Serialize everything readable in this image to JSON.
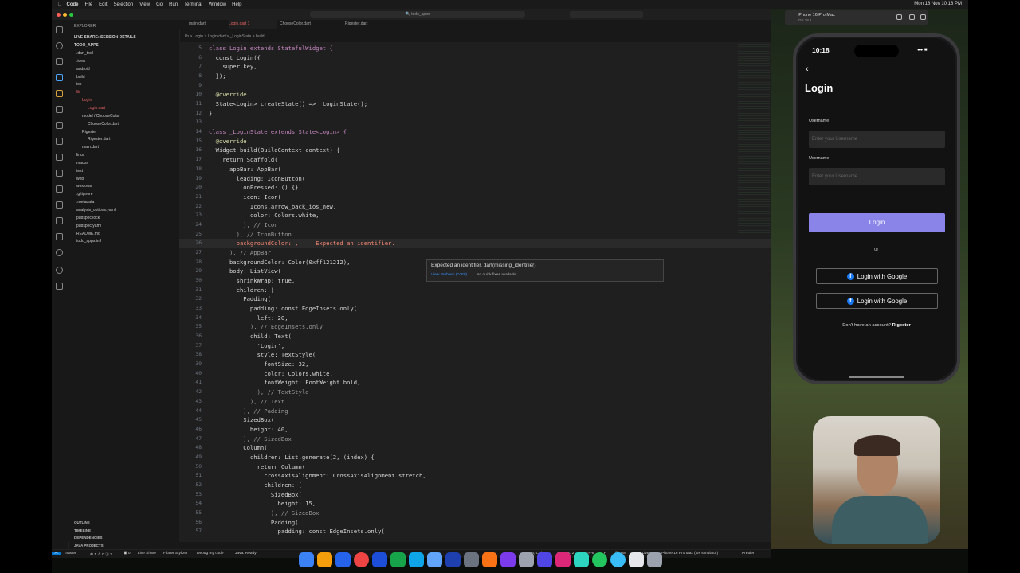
{
  "menubar": {
    "app": "Code",
    "items": [
      "File",
      "Edit",
      "Selection",
      "View",
      "Go",
      "Run",
      "Terminal",
      "Window",
      "Help"
    ],
    "clock": "Mon 18 Nov 10:18 PM"
  },
  "vscode": {
    "search": "todo_apps",
    "explorer": {
      "title": "EXPLORER",
      "live_share": "LIVE SHARE: SESSION DETAILS",
      "project": "TODO_APPS",
      "tree": [
        {
          "label": ".dart_tool",
          "indent": 1
        },
        {
          "label": ".idea",
          "indent": 1
        },
        {
          "label": "android",
          "indent": 1
        },
        {
          "label": "build",
          "indent": 1
        },
        {
          "label": "ios",
          "indent": 1
        },
        {
          "label": "lib",
          "indent": 1,
          "active": true
        },
        {
          "label": "Login",
          "indent": 2,
          "active": true
        },
        {
          "label": "Login.dart",
          "indent": 3,
          "active": true
        },
        {
          "label": "model / ChooseColor",
          "indent": 2
        },
        {
          "label": "ChooseColor.dart",
          "indent": 3
        },
        {
          "label": "Rigester",
          "indent": 2
        },
        {
          "label": "Rigester.dart",
          "indent": 3
        },
        {
          "label": "main.dart",
          "indent": 2
        },
        {
          "label": "linux",
          "indent": 1
        },
        {
          "label": "macos",
          "indent": 1
        },
        {
          "label": "test",
          "indent": 1
        },
        {
          "label": "web",
          "indent": 1
        },
        {
          "label": "windows",
          "indent": 1
        },
        {
          "label": ".gitignore",
          "indent": 1
        },
        {
          "label": ".metadata",
          "indent": 1
        },
        {
          "label": "analysis_options.yaml",
          "indent": 1
        },
        {
          "label": "pubspec.lock",
          "indent": 1
        },
        {
          "label": "pubspec.yaml",
          "indent": 1
        },
        {
          "label": "README.md",
          "indent": 1
        },
        {
          "label": "todo_apps.iml",
          "indent": 1
        }
      ],
      "bottom": [
        "OUTLINE",
        "TIMELINE",
        "DEPENDENCIES",
        "JAVA PROJECTS"
      ]
    },
    "tabs": [
      "main.dart",
      "Login.dart 1",
      "ChooseColor.dart",
      "Rigester.dart"
    ],
    "breadcrumb": "lib > Login > Login.dart > _LoginState > build",
    "code_lines": [
      {
        "n": "5",
        "t": "class Login extends StatefulWidget {"
      },
      {
        "n": "6",
        "t": "  const Login({"
      },
      {
        "n": "7",
        "t": "    super.key,"
      },
      {
        "n": "8",
        "t": "  });"
      },
      {
        "n": "9",
        "t": ""
      },
      {
        "n": "10",
        "t": "  @override"
      },
      {
        "n": "11",
        "t": "  State<Login> createState() => _LoginState();"
      },
      {
        "n": "12",
        "t": "}"
      },
      {
        "n": "13",
        "t": ""
      },
      {
        "n": "14",
        "t": "class _LoginState extends State<Login> {"
      },
      {
        "n": "15",
        "t": "  @override"
      },
      {
        "n": "16",
        "t": "  Widget build(BuildContext context) {"
      },
      {
        "n": "17",
        "t": "    return Scaffold("
      },
      {
        "n": "18",
        "t": "      appBar: AppBar("
      },
      {
        "n": "19",
        "t": "        leading: IconButton("
      },
      {
        "n": "20",
        "t": "          onPressed: () {},"
      },
      {
        "n": "21",
        "t": "          icon: Icon("
      },
      {
        "n": "22",
        "t": "            Icons.arrow_back_ios_new,"
      },
      {
        "n": "23",
        "t": "            color: Colors.white,"
      },
      {
        "n": "24",
        "t": "          ), // Icon"
      },
      {
        "n": "25",
        "t": "        ), // IconButton"
      },
      {
        "n": "26",
        "t": "        backgroundColor: ,     Expected an identifier."
      },
      {
        "n": "27",
        "t": "      ), // AppBar"
      },
      {
        "n": "28",
        "t": "      backgroundColor: Color(0xff121212),"
      },
      {
        "n": "29",
        "t": "      body: ListView("
      },
      {
        "n": "30",
        "t": "        shrinkWrap: true,"
      },
      {
        "n": "31",
        "t": "        children: ["
      },
      {
        "n": "32",
        "t": "          Padding("
      },
      {
        "n": "33",
        "t": "            padding: const EdgeInsets.only("
      },
      {
        "n": "34",
        "t": "              left: 20,"
      },
      {
        "n": "35",
        "t": "            ), // EdgeInsets.only"
      },
      {
        "n": "36",
        "t": "            child: Text("
      },
      {
        "n": "37",
        "t": "              'Login',"
      },
      {
        "n": "38",
        "t": "              style: TextStyle("
      },
      {
        "n": "39",
        "t": "                fontSize: 32,"
      },
      {
        "n": "40",
        "t": "                color: Colors.white,"
      },
      {
        "n": "41",
        "t": "                fontWeight: FontWeight.bold,"
      },
      {
        "n": "42",
        "t": "              ), // TextStyle"
      },
      {
        "n": "43",
        "t": "            ), // Text"
      },
      {
        "n": "44",
        "t": "          ), // Padding"
      },
      {
        "n": "45",
        "t": "          SizedBox("
      },
      {
        "n": "46",
        "t": "            height: 40,"
      },
      {
        "n": "47",
        "t": "          ), // SizedBox"
      },
      {
        "n": "48",
        "t": "          Column("
      },
      {
        "n": "49",
        "t": "            children: List.generate(2, (index) {"
      },
      {
        "n": "50",
        "t": "              return Column("
      },
      {
        "n": "51",
        "t": "                crossAxisAlignment: CrossAxisAlignment.stretch,"
      },
      {
        "n": "52",
        "t": "                children: ["
      },
      {
        "n": "53",
        "t": "                  SizedBox("
      },
      {
        "n": "54",
        "t": "                    height: 15,"
      },
      {
        "n": "55",
        "t": "                  ), // SizedBox"
      },
      {
        "n": "56",
        "t": "                  Padding("
      },
      {
        "n": "57",
        "t": "                    padding: const EdgeInsets.only("
      }
    ],
    "hover": {
      "message": "Expected an identifier. dart(missing_identifier)",
      "view_problem": "View Problem (⌥F8)",
      "no_fixes": "No quick fixes available"
    },
    "status": {
      "branch": "master",
      "problems": "⊗ 1 ⚠ 0 ⓘ 3",
      "ports": "▣ 0",
      "live": "Live Share",
      "stylizer": "Flutter Stylizer",
      "debug": "Debug my code",
      "java": "Java: Ready",
      "position": "Ln 26, Col 25",
      "spaces": "Spaces: 2",
      "encoding": "UTF-8",
      "eol": "LF",
      "lang": "{} Dart",
      "golive": "Go Live",
      "device": "iPhone 16 Pro Max (ios simulator)",
      "prettier": "Prettier"
    }
  },
  "simulator": {
    "title": "iPhone 16 Pro Max",
    "subtitle": "iOS 18.1",
    "time": "10:18",
    "page_title": "Login",
    "fields": [
      {
        "label": "Username",
        "placeholder": "Enter your Username"
      },
      {
        "label": "Username",
        "placeholder": "Enter your Username"
      }
    ],
    "login_button": "Login",
    "or": "or",
    "social": [
      "Login with Google",
      "Login with Google"
    ],
    "no_account": "Don't have an account?",
    "register": "Rigester",
    "accent": "#8a83e8"
  }
}
